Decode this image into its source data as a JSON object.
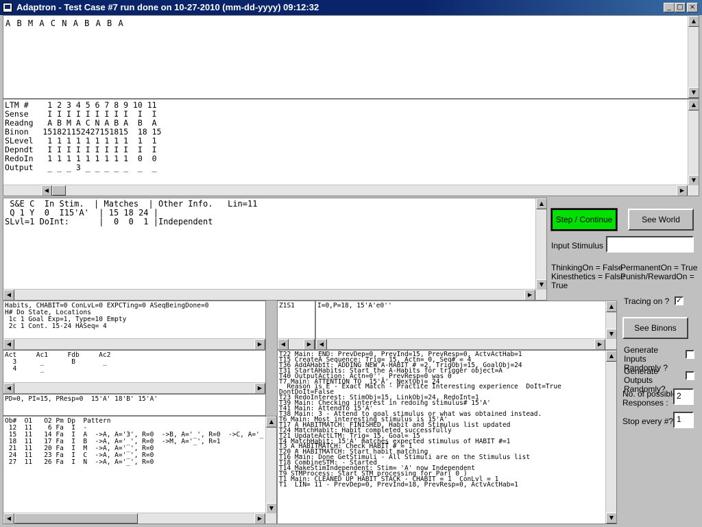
{
  "window": {
    "title": "Adaptron - Test Case #7 run done on 10-27-2010 (mm-dd-yyyy) 09:12:32"
  },
  "controls": {
    "minimize": "_",
    "maximize": "□",
    "close": "×"
  },
  "stimulus_history": "A B M A C N A B A B A",
  "ltm_table": "LTM #    1 2 3 4 5 6 7 8 9 10 11\nSense    I I I I I I I I I  I  I\nReadng   A B M A C N A B A  B  A\nBinon   151821152427151815  18 15\nSLevel   1 1 1 1 1 1 1 1 1  1  1\nDepndt   I I I I I I I I I  I  I\nRedoIn   1 1 1 1 1 1 1 1 1  0  0\nOutput   _ _ _ 3 _ _ _ _ _  _  _",
  "stim_panel": " S&E C  In Stim.  | Matches  | Other Info.   Lin=11\n Q 1 Y  0  I15'A'  | 15 18 24 |\nSLvl=1 DoInt:      |  0  0  1 |Independent",
  "habits_panel": "Habits, CHABIT=0 ConLvL=0 EXPCTing=0 ASeqBeingDone=0\nH# Do State, Locations\n 1c 1 Goal Exp=1, Type=10 Empty\n 2c 1 Cont. 15-24 HASeq= 4",
  "act_panel": "Act     Ac1     Fdb     Ac2\n  3      _       B       _\n  4      _",
  "pd_panel": "PD=0, PI=15, PResp=0  15'A' 18'B' 15'A'",
  "ob_panel": "Ob#  O1   O2 Pm Dp  Pattern\n 12  11    6 Fa  I  -\n 15  11   14 Fa  I  A  ->A, A='3', R=0  ->B, A='_', R=0  ->C, A='_\n 18  11   17 Fa  I  B  ->A, A='_', R=0  ->M, A='_', R=1\n 21  11   20 Fa  I  M  ->A, A='_', R=0\n 24  11   23 Fa  I  C  ->A, A='_', R=0\n 27  11   26 Fa  I  N  ->A, A='_', R=0",
  "z_panel": "Z1S1",
  "i_panel": "I=0,P=18, 15'A'e0''",
  "trace_log": "T22 Main: END: PrevDep=0, PrevInd=15, PrevResp=0, ActvActHab=1\nT15 CreateA_Sequence: Trig= 15, Actn= 0, Seq# = 4\nT36 AddAHabit: ADDING NEW A-HABIT # =2, TrigObj=15, GoalObj=24\nT31 StartAHabits: Start the A-Habits for trigger object=A\nT40 OutputAction: Actn=0'', PrevResp=0 was 0\nT7 Main: ATTENTION TO  15'A', NextObj= 24\n  Reason is E - Exact Match - Practice Interesting experience  DoIt=True\nDontDoIt=False\nT23 RedoInterest: StimObj=15, LinkObj=24, RedoInt=1\nT39 Main: Checking interest in redoing stimulus# 15'A'\nT41 Main: AttendTo 15'A'\nT38 Main: 3 - Attend to goal stimulus or what was obtained instead.\nT6 Main: Most interesting stimulus is 15'A'\nT17 A_HABITMATCH: FINISHED, Habit and Stimulus list updated\nT24 MatchHabit: Habit completed successfully\nT21 UpdateActLTM: Trig= 15, Goal= 15\nT4 MatchHabit: 15'A' matches expected stimulus of HABIT #=1\nT3 A_HABITMATCH: Check HABIT # = 1\nT20 A_HABITMATCH: Start habit matching\nT16 Main: Done GetStimuli - All Stimuli are on the Stimulus list\nT18 CombineSTM: - Started\nT14 MakeStimIndependent: Stim= 'A' now Independent\nT9 STMProcess: Start STM processing for Par( 0 )\nT1 Main: CLEANED UP HABIT STACK - CHABIT = 1  ConLvl = 1\nT1  LIN= 11 - PrevDep=0, PrevInd=18, PrevResp=0, ActvActHab=1",
  "buttons": {
    "step": "Step / Continue",
    "see_world": "See World",
    "see_binons": "See Binons"
  },
  "input_stimulus": {
    "label": "Input Stimulus :",
    "value": ""
  },
  "status": {
    "thinking": "ThinkingOn = False",
    "permanent": "PermanentOn = True",
    "kinesthetics": "Kinesthetics = False",
    "punish": "Punish/RewardOn =",
    "true_word": "True"
  },
  "tracing": {
    "label": "Tracing on ?",
    "checked": true
  },
  "gen_inputs": {
    "label": "Generate Inputs Randomly ?",
    "checked": false
  },
  "gen_outputs": {
    "label": "Generate Outputs Randomly?",
    "checked": false
  },
  "responses": {
    "label": "No. of possible Responses :",
    "value": "2"
  },
  "stop_every": {
    "label": "Stop every #?",
    "value": "1"
  },
  "colors": {
    "step_button": "#00e000",
    "titlebar": "#0a246a",
    "face": "#c0c0c0"
  }
}
